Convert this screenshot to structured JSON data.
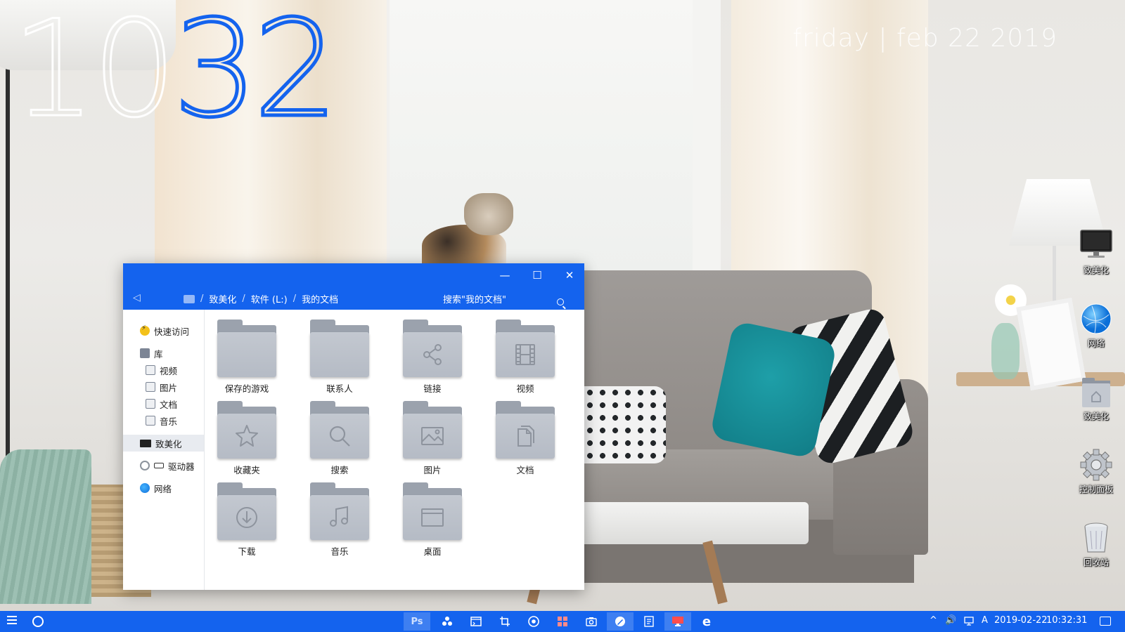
{
  "clock": {
    "hours": "10",
    "minutes": "32"
  },
  "date": "friday | feb 22 2019",
  "desktop_icons": [
    {
      "label": "致美化",
      "icon": "monitor-icon"
    },
    {
      "label": "网络",
      "icon": "network-globe-icon"
    },
    {
      "label": "致美化",
      "icon": "home-folder-icon"
    },
    {
      "label": "控制面板",
      "icon": "gear-icon"
    },
    {
      "label": "回收站",
      "icon": "recycle-bin-icon"
    }
  ],
  "explorer": {
    "window_buttons": {
      "minimize": "—",
      "maximize": "☐",
      "close": "✕"
    },
    "back": "◁",
    "breadcrumb": [
      "致美化",
      "软件 (L:)",
      "我的文档"
    ],
    "breadcrumb_sep": "/",
    "search_placeholder": "搜索\"我的文档\"",
    "nav": {
      "quick_access": "快速访问",
      "library": "库",
      "library_items": [
        "视频",
        "图片",
        "文档",
        "音乐"
      ],
      "this_pc": "致美化",
      "drives": "驱动器",
      "network": "网络"
    },
    "folders": [
      {
        "label": "保存的游戏",
        "icon": "none"
      },
      {
        "label": "联系人",
        "icon": "none"
      },
      {
        "label": "链接",
        "icon": "share-icon"
      },
      {
        "label": "视频",
        "icon": "film-icon"
      },
      {
        "label": "收藏夹",
        "icon": "star-icon"
      },
      {
        "label": "搜索",
        "icon": "search-icon"
      },
      {
        "label": "图片",
        "icon": "image-icon"
      },
      {
        "label": "文档",
        "icon": "document-icon"
      },
      {
        "label": "下载",
        "icon": "download-icon"
      },
      {
        "label": "音乐",
        "icon": "music-note-icon"
      },
      {
        "label": "桌面",
        "icon": "desktop-window-icon"
      }
    ]
  },
  "taskbar": {
    "apps": [
      {
        "label": "Ps",
        "icon": "photoshop-icon"
      },
      {
        "label": "",
        "icon": "biohazard-icon"
      },
      {
        "label": "",
        "icon": "terminal-icon"
      },
      {
        "label": "",
        "icon": "crop-icon"
      },
      {
        "label": "",
        "icon": "chrome-icon"
      },
      {
        "label": "",
        "icon": "grid-app-icon"
      },
      {
        "label": "",
        "icon": "camera-icon"
      },
      {
        "label": "",
        "icon": "pen-app-icon"
      },
      {
        "label": "",
        "icon": "notepad-icon"
      },
      {
        "label": "",
        "icon": "remote-desktop-icon"
      },
      {
        "label": "e",
        "icon": "ie-icon"
      }
    ],
    "tray_chevron": "^",
    "volume": "🔊",
    "ime": "A",
    "date": "2019-02-22",
    "time": "10:32:31"
  },
  "colors": {
    "accent": "#1463ee",
    "folder": "#b9bec7"
  }
}
